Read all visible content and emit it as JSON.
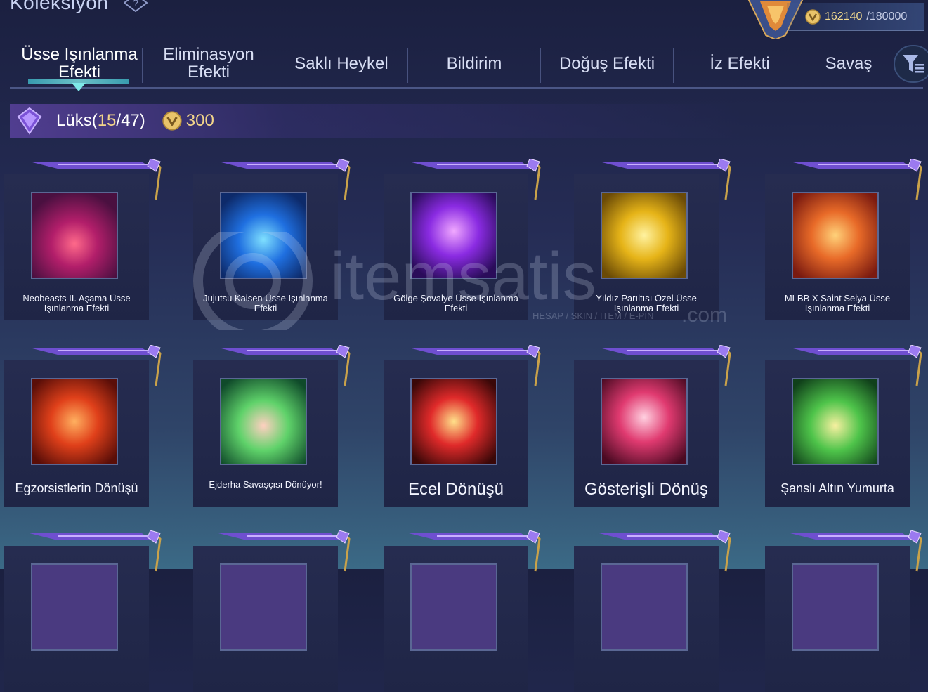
{
  "header": {
    "title": "Koleksiyon"
  },
  "points": {
    "current": "162140",
    "separator": "/",
    "max": "180000"
  },
  "tabs": [
    {
      "label": "Üsse Işınlanma Efekti",
      "active": true
    },
    {
      "label": "Eliminasyon Efekti"
    },
    {
      "label": "Saklı Heykel"
    },
    {
      "label": "Bildirim"
    },
    {
      "label": "Doğuş Efekti"
    },
    {
      "label": "İz Efekti"
    },
    {
      "label": "Savaş"
    }
  ],
  "section": {
    "label": "Lüks",
    "owned": "15",
    "total": "47",
    "open": "(",
    "slash": "/",
    "close": ")",
    "price": "300"
  },
  "items": [
    {
      "name": "Neobeasts II. Aşama Üsse Işınlanma Efekti"
    },
    {
      "name": "Jujutsu Kaisen Üsse Işınlanma Efekti"
    },
    {
      "name": "Gölge Şovalye Üsse Işınlanma Efekti"
    },
    {
      "name": "Yıldız Parıltısı Özel Üsse Işınlanma Efekti"
    },
    {
      "name": "MLBB X Saint Seiya Üsse Işınlanma Efekti"
    },
    {
      "name": "Egzorsistlerin Dönüşü"
    },
    {
      "name": "Ejderha Savaşçısı Dönüyor!"
    },
    {
      "name": "Ecel Dönüşü"
    },
    {
      "name": "Gösterişli Dönüş"
    },
    {
      "name": "Şanslı Altın Yumurta"
    }
  ],
  "watermark": {
    "brand": "itemsatis",
    "tld": ".com",
    "tagline": "HESAP / SKIN / ITEM / E-PIN"
  },
  "colors": {
    "accent_gold": "#f2d58a",
    "accent_purple": "#8e6be0",
    "active_underline": "#7ee8e8"
  }
}
